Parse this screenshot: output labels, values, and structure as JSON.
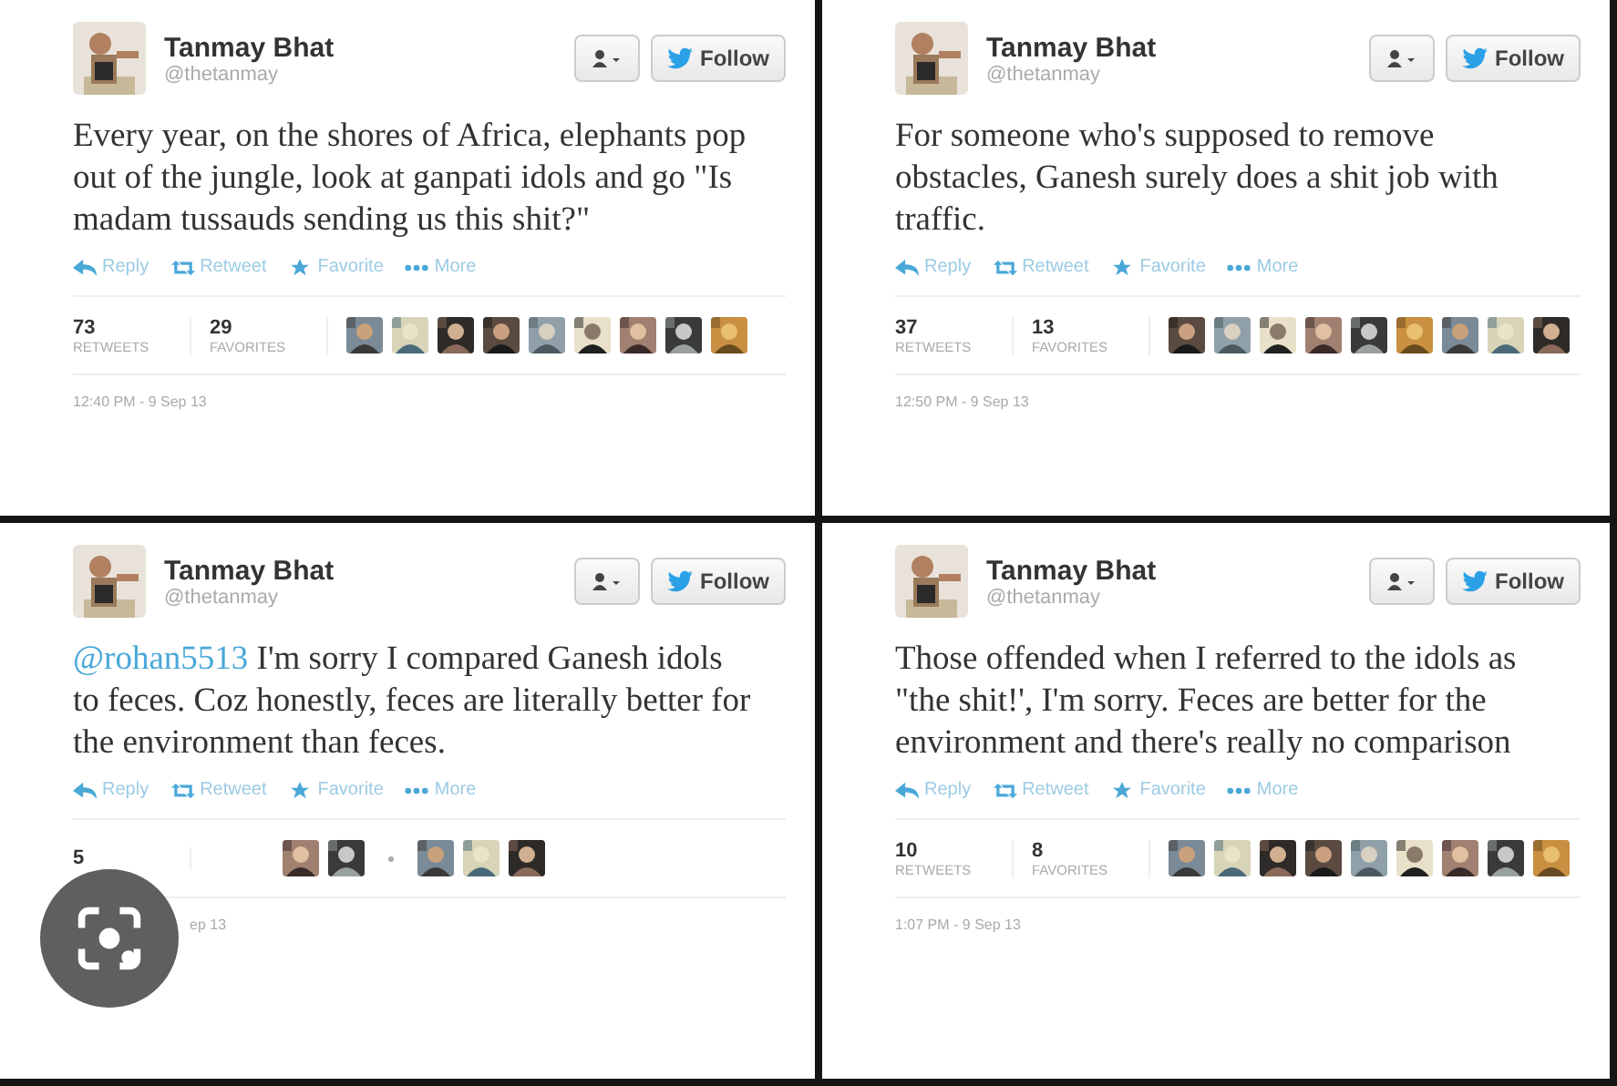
{
  "tweets": [
    {
      "name": "Tanmay Bhat",
      "handle": "@thetanmay",
      "follow": "Follow",
      "text": "Every year, on the shores of Africa, elephants pop out of the jungle, look at ganpati idols and go \"Is madam tussauds sending us this shit?\"",
      "actions": [
        "Reply",
        "Retweet",
        "Favorite",
        "More"
      ],
      "stats": [
        {
          "count": "73",
          "label": "RETWEETS"
        },
        {
          "count": "29",
          "label": "FAVORITES"
        }
      ],
      "faces": [
        {
          "kind": "picture"
        },
        {
          "kind": "picture"
        },
        {
          "kind": "picture"
        },
        {
          "kind": "picture"
        },
        {
          "kind": "picture"
        },
        {
          "kind": "picture"
        },
        {
          "kind": "picture"
        },
        {
          "kind": "picture"
        },
        {
          "kind": "picture"
        }
      ],
      "time": "12:40 PM - 9 Sep 13"
    },
    {
      "name": "Tanmay Bhat",
      "handle": "@thetanmay",
      "follow": "Follow",
      "text": "For someone who's supposed to remove obstacles, Ganesh surely does a shit job with traffic.",
      "actions": [
        "Reply",
        "Retweet",
        "Favorite",
        "More"
      ],
      "stats": [
        {
          "count": "37",
          "label": "RETWEETS"
        },
        {
          "count": "13",
          "label": "FAVORITES"
        }
      ],
      "faces": [
        {
          "kind": "picture"
        },
        {
          "kind": "picture"
        },
        {
          "kind": "picture"
        },
        {
          "kind": "picture"
        },
        {
          "kind": "picture"
        },
        {
          "kind": "picture"
        },
        {
          "kind": "picture"
        },
        {
          "kind": "picture"
        },
        {
          "kind": "picture"
        }
      ],
      "time": "12:50 PM - 9 Sep 13"
    },
    {
      "name": "Tanmay Bhat",
      "handle": "@thetanmay",
      "follow": "Follow",
      "mention": "@rohan5513",
      "text": " I'm sorry I compared Ganesh idols to feces. Coz honestly, feces are literally better for the environment than feces.",
      "actions": [
        "Reply",
        "Retweet",
        "Favorite",
        "More"
      ],
      "stats": [
        {
          "count": "5"
        }
      ],
      "faces": [
        {
          "kind": "picture"
        },
        {
          "kind": "picture"
        },
        {
          "kind": "separator"
        },
        {
          "kind": "picture"
        },
        {
          "kind": "picture"
        },
        {
          "kind": "picture"
        }
      ],
      "time": "ep 13",
      "lens": true
    },
    {
      "name": "Tanmay Bhat",
      "handle": "@thetanmay",
      "follow": "Follow",
      "text": "Those offended when I referred to the idols as \"the shit!', I'm sorry. Feces are better for the environment and there's really no comparison",
      "actions": [
        "Reply",
        "Retweet",
        "Favorite",
        "More"
      ],
      "stats": [
        {
          "count": "10",
          "label": "RETWEETS"
        },
        {
          "count": "8",
          "label": "FAVORITES"
        }
      ],
      "faces": [
        {
          "kind": "picture"
        },
        {
          "kind": "picture"
        },
        {
          "kind": "picture"
        },
        {
          "kind": "picture"
        },
        {
          "kind": "picture"
        },
        {
          "kind": "picture"
        },
        {
          "kind": "picture"
        },
        {
          "kind": "picture"
        },
        {
          "kind": "picture"
        }
      ],
      "time": "1:07 PM - 9 Sep 13"
    }
  ]
}
